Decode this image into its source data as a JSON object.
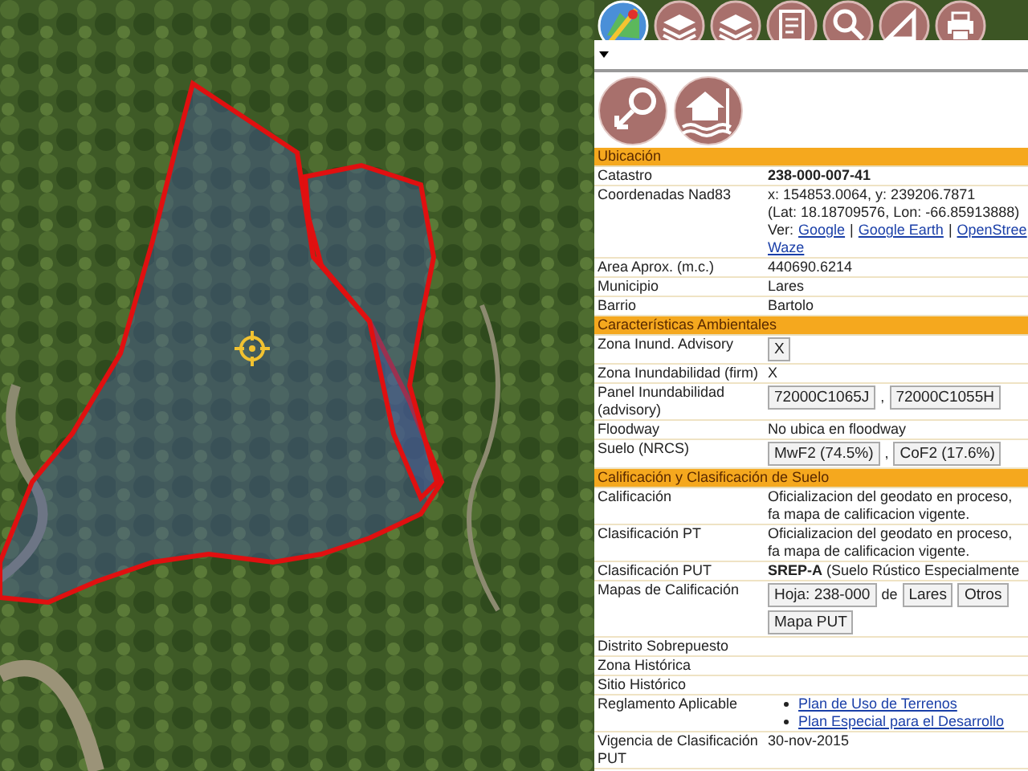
{
  "sections": [
    {
      "title": "Ubicación",
      "rows": [
        {
          "label": "Catastro",
          "lines": [
            [
              {
                "kind": "strong",
                "text": "238-000-007-41"
              }
            ]
          ]
        },
        {
          "label": "Coordenadas Nad83",
          "lines": [
            [
              {
                "kind": "text",
                "text": "x: 154853.0064, y: 239206.7871"
              }
            ],
            [
              {
                "kind": "text",
                "text": "(Lat: 18.18709576, Lon: -66.85913888)"
              }
            ],
            [
              {
                "kind": "text",
                "text": "Ver:"
              },
              {
                "kind": "link",
                "text": "Google"
              },
              {
                "kind": "text",
                "text": "|"
              },
              {
                "kind": "link",
                "text": "Google Earth"
              },
              {
                "kind": "text",
                "text": "|"
              },
              {
                "kind": "link",
                "text": "OpenStree"
              }
            ],
            [
              {
                "kind": "link",
                "text": "Waze"
              }
            ]
          ]
        },
        {
          "label": "Area Aprox. (m.c.)",
          "lines": [
            [
              {
                "kind": "text",
                "text": "440690.6214"
              }
            ]
          ]
        },
        {
          "label": "Municipio",
          "lines": [
            [
              {
                "kind": "text",
                "text": "Lares"
              }
            ]
          ]
        },
        {
          "label": "Barrio",
          "lines": [
            [
              {
                "kind": "text",
                "text": "Bartolo"
              }
            ]
          ]
        }
      ]
    },
    {
      "title": "Características Ambientales",
      "rows": [
        {
          "label": "Zona Inund. Advisory",
          "lines": [
            [
              {
                "kind": "button",
                "text": "X"
              }
            ]
          ]
        },
        {
          "label": "Zona Inundabilidad (firm)",
          "lines": [
            [
              {
                "kind": "text",
                "text": "X"
              }
            ]
          ]
        },
        {
          "label": "Panel Inundabilidad (advisory)",
          "lines": [
            [
              {
                "kind": "button",
                "text": "72000C1065J"
              },
              {
                "kind": "text",
                "text": ","
              },
              {
                "kind": "button",
                "text": "72000C1055H"
              }
            ]
          ]
        },
        {
          "label": "Floodway",
          "lines": [
            [
              {
                "kind": "text",
                "text": "No ubica en floodway"
              }
            ]
          ]
        },
        {
          "label": "Suelo (NRCS)",
          "lines": [
            [
              {
                "kind": "button",
                "text": "MwF2 (74.5%)"
              },
              {
                "kind": "text",
                "text": ","
              },
              {
                "kind": "button",
                "text": "CoF2 (17.6%)"
              }
            ]
          ]
        }
      ]
    },
    {
      "title": "Calificación y Clasificación de Suelo",
      "rows": [
        {
          "label": "Calificación",
          "lines": [
            [
              {
                "kind": "text",
                "text": "Oficializacion del geodato en proceso, fa mapa de calificacion vigente."
              }
            ]
          ]
        },
        {
          "label": "Clasificación PT",
          "lines": [
            [
              {
                "kind": "text",
                "text": "Oficializacion del geodato en proceso, fa mapa de calificacion vigente."
              }
            ]
          ]
        },
        {
          "label": "Clasificación PUT",
          "lines": [
            [
              {
                "kind": "rich",
                "text": "**SREP-A** (Suelo Rústico Especialmente"
              }
            ]
          ]
        },
        {
          "label": "Mapas de Calificación",
          "lines": [
            [
              {
                "kind": "button",
                "text": "Hoja: 238-000"
              },
              {
                "kind": "text",
                "text": "de"
              },
              {
                "kind": "button",
                "text": "Lares"
              },
              {
                "kind": "button",
                "text": "Otros"
              }
            ],
            [
              {
                "kind": "button",
                "text": "Mapa PUT"
              }
            ]
          ]
        },
        {
          "label": "Distrito Sobrepuesto",
          "lines": []
        },
        {
          "label": "Zona Histórica",
          "lines": []
        },
        {
          "label": "Sitio Histórico",
          "lines": []
        },
        {
          "label": "Reglamento Aplicable",
          "lines": [
            [
              {
                "kind": "bullet_link",
                "text": "Plan de Uso de Terrenos"
              }
            ],
            [
              {
                "kind": "bullet_link",
                "text": "Plan Especial para el Desarrollo"
              }
            ]
          ]
        },
        {
          "label": "Vigencia de Clasificación PUT",
          "lines": [
            [
              {
                "kind": "text",
                "text": "30-nov-2015"
              }
            ]
          ]
        }
      ]
    }
  ]
}
